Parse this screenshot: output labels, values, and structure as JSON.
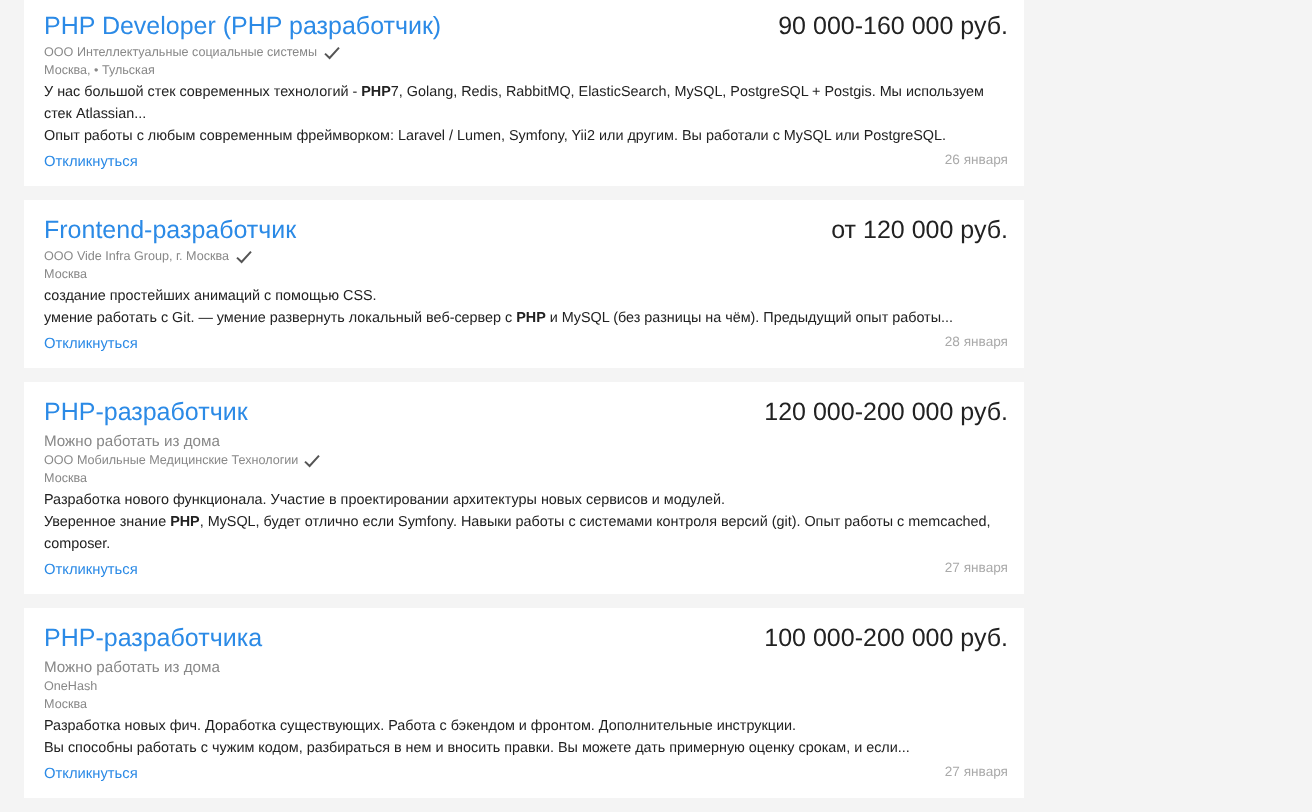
{
  "vacancies": [
    {
      "title": "PHP Developer (PHP разработчик)",
      "salary": "90 000-160 000 руб.",
      "company": "ООО Интеллектуальные социальные системы",
      "verified": true,
      "location": "Москва, • Тульская",
      "description": [
        "У нас большой стек современных технологий - **PHP**7, Golang, Redis, RabbitMQ, ElasticSearch, MySQL, PostgreSQL + Postgis. Мы используем стек Atlassian...",
        "Опыт работы с любым современным фреймворком: Laravel / Lumen, Symfony, Yii2 или другим. Вы работали с MySQL или PostgreSQL."
      ],
      "respond": "Откликнуться",
      "date": "26 января"
    },
    {
      "title": "Frontend-разработчик",
      "salary": "от 120 000 руб.",
      "company": "ООО Vide Infra Group, г. Москва",
      "verified": true,
      "location": "Москва",
      "description": [
        "создание простейших анимаций с помощью CSS.",
        "умение работать с Git. — умение развернуть локальный веб-сервер с **PHP** и MySQL (без разницы на чём). Предыдущий опыт работы..."
      ],
      "respond": "Откликнуться",
      "date": "28 января"
    },
    {
      "title": "PHP-разработчик",
      "salary": "120 000-200 000 руб.",
      "remote": "Можно работать из дома",
      "company": "ООО Мобильные Медицинские Технологии",
      "verified": true,
      "location": "Москва",
      "description": [
        "Разработка нового функционала. Участие в проектировании архитектуры новых сервисов и модулей.",
        "Уверенное знание **PHP**, MySQL, будет отлично если Symfony. Навыки работы с системами контроля версий (git). Опыт работы с memcached, composer."
      ],
      "respond": "Откликнуться",
      "date": "27 января"
    },
    {
      "title": "PHP-разработчика",
      "salary": "100 000-200 000 руб.",
      "remote": "Можно работать из дома",
      "company": "OneHash",
      "verified": false,
      "location": "Москва",
      "description": [
        "Разработка новых фич. Доработка существующих. Работа с бэкендом и фронтом. Дополнительные инструкции.",
        "Вы способны работать с чужим кодом, разбираться в нем и вносить правки. Вы можете дать примерную оценку срокам, и если..."
      ],
      "respond": "Откликнуться",
      "date": "27 января"
    }
  ]
}
